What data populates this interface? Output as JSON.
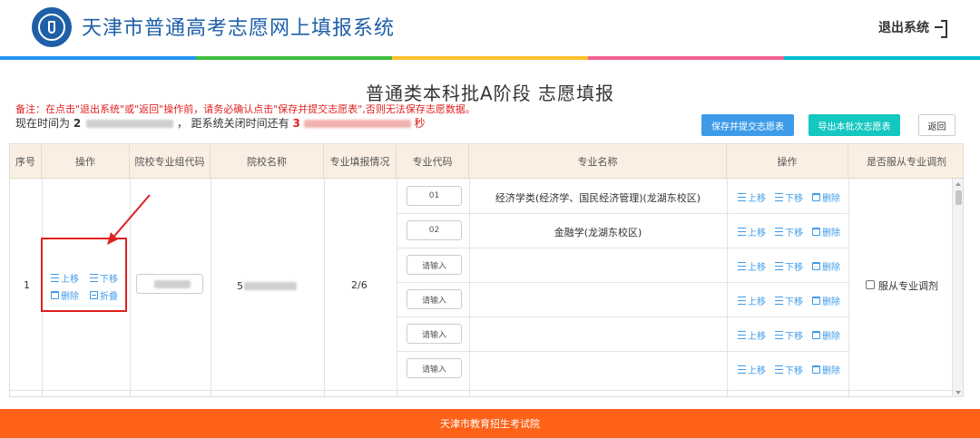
{
  "header": {
    "site_title": "天津市普通高考志愿网上填报系统",
    "logout_label": "退出系统",
    "rainbow_colors": [
      "#2196f3",
      "#3fbf3f",
      "#fbc02d",
      "#f06292",
      "#00bcd4"
    ]
  },
  "page": {
    "title": "普通类本科批A阶段 志愿填报",
    "note": "备注：在点击\"退出系统\"或\"返回\"操作前，请务必确认点击\"保存并提交志愿表\",否则无法保存志愿数据。",
    "time_prefix": "现在时间为",
    "time_value": "2",
    "time_middle": "， 距系统关闭时间还有",
    "countdown_value": "3",
    "countdown_suffix": "秒"
  },
  "toolbar": {
    "save_label": "保存并提交志愿表",
    "export_label": "导出本批次志愿表",
    "back_label": "返回"
  },
  "table": {
    "headers": [
      "序号",
      "操作",
      "院校专业组代码",
      "院校名称",
      "专业填报情况",
      "专业代码",
      "专业名称",
      "操作",
      "是否服从专业调剂"
    ],
    "row": {
      "index": "1",
      "group_code": "",
      "school_name": "5",
      "major_fill_status": "2/6",
      "ops": {
        "up": "上移",
        "down": "下移",
        "delete": "删除",
        "fold": "折叠"
      },
      "accept_adjust_label": "服从专业调剂",
      "accept_adjust_checked": false
    },
    "majors": [
      {
        "code": "01",
        "name": "经济学类(经济学、国民经济管理)(龙湖东校区)"
      },
      {
        "code": "02",
        "name": "金融学(龙湖东校区)"
      },
      {
        "code": "请输入",
        "name": ""
      },
      {
        "code": "请输入",
        "name": ""
      },
      {
        "code": "请输入",
        "name": ""
      },
      {
        "code": "请输入",
        "name": ""
      }
    ],
    "major_ops": {
      "up": "上移",
      "down": "下移",
      "delete": "删除"
    }
  },
  "footer": {
    "text": "天津市教育招生考试院"
  },
  "colors": {
    "brand_blue": "#1e5fa8",
    "accent_blue": "#3d9be9",
    "teal": "#14c7c0",
    "orange": "#fd6218",
    "red": "#e02020",
    "header_bg": "#fbefe3"
  }
}
